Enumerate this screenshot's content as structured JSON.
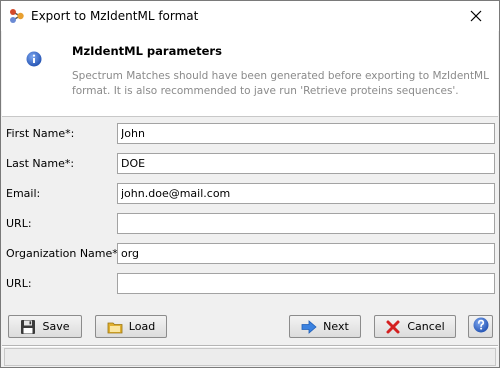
{
  "window": {
    "title": "Export to MzIdentML format",
    "close_icon": "close-icon",
    "app_icon": "molecule-icon"
  },
  "header": {
    "title": "MzIdentML parameters",
    "description": "Spectrum Matches should have been generated before exporting to MzIdentML format. It is also recommended to jave run 'Retrieve proteins sequences'.",
    "icon": "info-icon"
  },
  "form": {
    "fields": [
      {
        "label": "First Name*:",
        "value": "John"
      },
      {
        "label": "Last Name*:",
        "value": "DOE"
      },
      {
        "label": "Email:",
        "value": "john.doe@mail.com"
      },
      {
        "label": "URL:",
        "value": ""
      },
      {
        "label": "Organization Name*:",
        "value": "org"
      },
      {
        "label": "URL:",
        "value": ""
      }
    ]
  },
  "buttons": {
    "save": "Save",
    "load": "Load",
    "next": "Next",
    "cancel": "Cancel",
    "help_icon": "help-icon"
  },
  "colors": {
    "accent_blue": "#2f6fd6",
    "cancel_red": "#d42020",
    "folder_yellow": "#f0c040"
  }
}
